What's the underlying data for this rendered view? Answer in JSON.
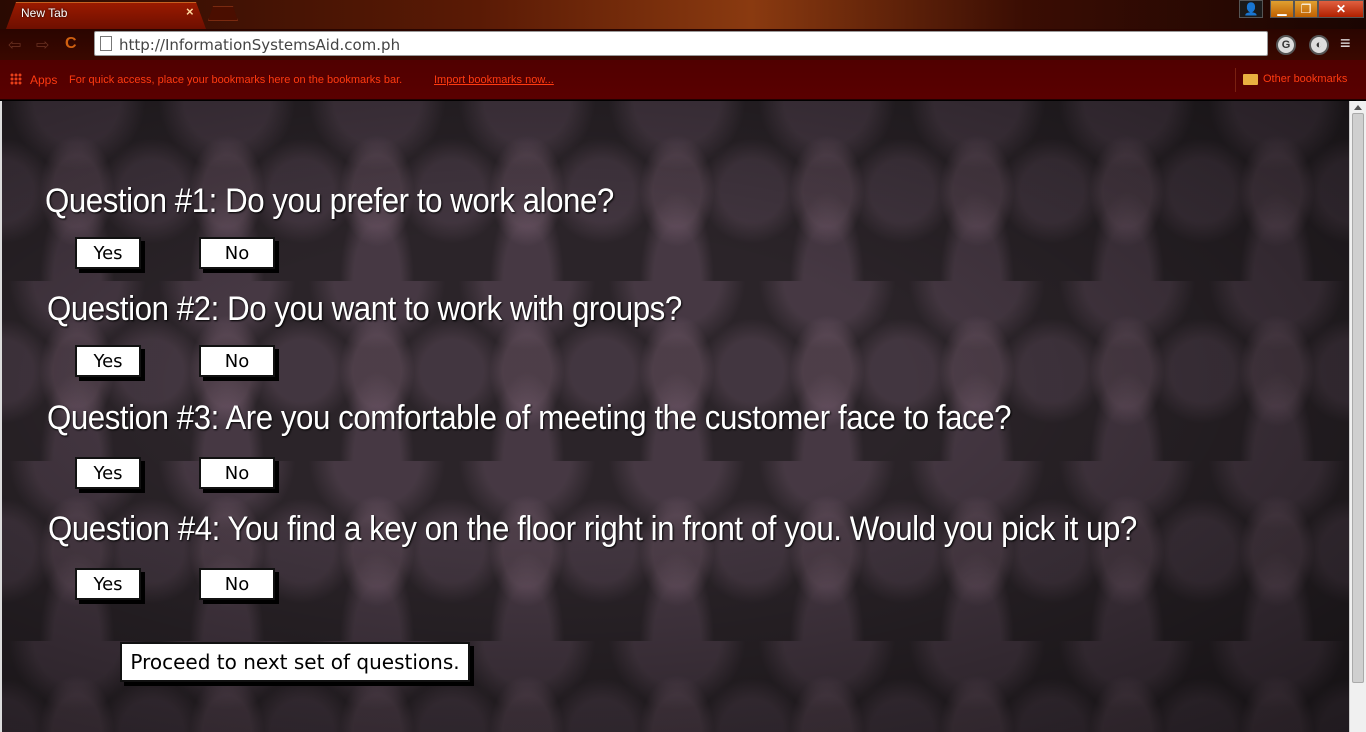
{
  "browser": {
    "tab_title": "New Tab",
    "tab_close": "×",
    "url": "http://InformationSystemsAid.com.ph",
    "window_controls": {
      "user": "👤",
      "minimize": "▁",
      "maximize": "❐",
      "close": "✕"
    },
    "nav": {
      "back": "⇦",
      "forward": "⇨",
      "reload": "C"
    },
    "menu": "≡",
    "bookmarks_bar": {
      "apps_label": "Apps",
      "hint": "For quick access, place your bookmarks here on the bookmarks bar.",
      "import_link": "Import bookmarks now...",
      "other_bookmarks": "Other bookmarks"
    }
  },
  "quiz": {
    "questions": [
      {
        "text": "Question #1: Do you prefer to work alone?",
        "yes": "Yes",
        "no": "No"
      },
      {
        "text": "Question #2: Do you want to work with groups?",
        "yes": "Yes",
        "no": "No"
      },
      {
        "text": "Question #3: Are you comfortable of meeting the customer face to face?",
        "yes": "Yes",
        "no": "No"
      },
      {
        "text": "Question #4: You find a key on the floor right in front of you. Would you pick it up?",
        "yes": "Yes",
        "no": "No"
      }
    ],
    "proceed_label": "Proceed to next set of questions."
  }
}
